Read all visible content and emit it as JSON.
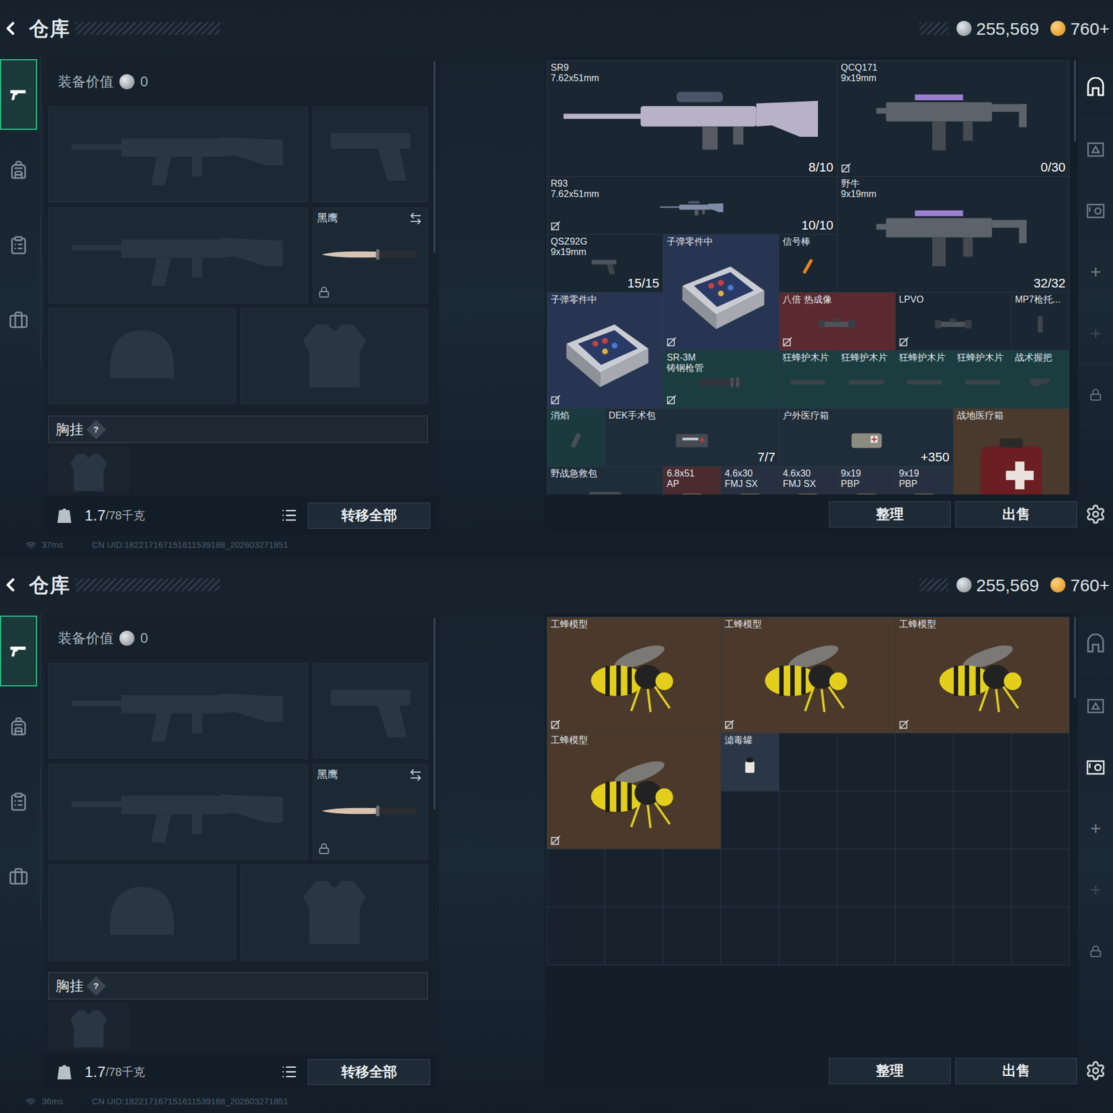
{
  "screens": [
    {
      "header": {
        "title": "仓库",
        "currency": [
          {
            "value": "255,569",
            "kind": "silver"
          },
          {
            "value": "760+",
            "kind": "gold"
          }
        ]
      },
      "side_tabs": [
        {
          "kind": "weapons",
          "selected": true
        },
        {
          "kind": "gear",
          "selected": false
        },
        {
          "kind": "tasks",
          "selected": false
        },
        {
          "kind": "cases",
          "selected": false
        }
      ],
      "loadout": {
        "value_label": "装备价值",
        "value": "0",
        "knife": {
          "name": "黑鹰",
          "locked": true
        },
        "chest_rig": {
          "label": "胸挂",
          "help": "?"
        },
        "weight": "1.7",
        "capacity": "/78千克",
        "transfer_button": "转移全部"
      },
      "stash": {
        "items": [
          {
            "name": "SR9",
            "subtitle": "7.62x51mm",
            "count": "8/10",
            "color": "#1a2631",
            "marked": false,
            "kind": "rifle"
          },
          {
            "name": "QCQ171",
            "subtitle": "9x19mm",
            "count": "0/30",
            "color": "#1a2631",
            "marked": true,
            "kind": "smg"
          },
          {
            "name": "R93",
            "subtitle": "7.62x51mm",
            "count": "10/10",
            "color": "#1a2631",
            "marked": true,
            "kind": "sniper"
          },
          {
            "name": "野牛",
            "subtitle": "9x19mm",
            "count": "32/32",
            "color": "#1a2631",
            "marked": false,
            "kind": "smg"
          },
          {
            "name": "QSZ92G",
            "subtitle": "9x19mm",
            "count": "15/15",
            "color": "#1a2631",
            "marked": false,
            "kind": "pistol"
          },
          {
            "name": "子弹零件中",
            "color": "#283552",
            "marked": true,
            "kind": "ammobox"
          },
          {
            "name": "信号棒",
            "color": "#1a2631",
            "marked": false,
            "kind": "flare"
          },
          {
            "name": "子弹零件中",
            "color": "#283552",
            "marked": true,
            "kind": "ammobox"
          },
          {
            "name": "八倍 热成像",
            "color": "#5b2a30",
            "marked": true,
            "kind": "scope"
          },
          {
            "name": "LPVO",
            "color": "#1a2631",
            "marked": true,
            "kind": "scope"
          },
          {
            "name": "MP7枪托...",
            "color": "#1a2631",
            "marked": false,
            "kind": "stock"
          },
          {
            "name": "SR-3M",
            "subtitle": "铸钢枪管",
            "color": "#1b3d40",
            "marked": true,
            "kind": "barrel"
          },
          {
            "name": "狂蜂护木片",
            "color": "#1b3d40",
            "marked": false,
            "kind": "handguard"
          },
          {
            "name": "狂蜂护木片",
            "color": "#1b3d40",
            "marked": false,
            "kind": "handguard"
          },
          {
            "name": "狂蜂护木片",
            "color": "#1b3d40",
            "marked": false,
            "kind": "handguard"
          },
          {
            "name": "狂蜂护木片",
            "color": "#1b3d40",
            "marked": false,
            "kind": "handguard"
          },
          {
            "name": "战术握把",
            "color": "#1b3d40",
            "marked": false,
            "kind": "grip"
          },
          {
            "name": "消焰",
            "color": "#1b3a3d",
            "marked": false,
            "kind": "muzzle"
          },
          {
            "name": "DEK手术包",
            "count": "7/7",
            "color": "#1f2c3a",
            "marked": false,
            "kind": "medkit"
          },
          {
            "name": "户外医疗箱",
            "count": "+350",
            "color": "#1f2c3a",
            "marked": false,
            "kind": "medbag"
          },
          {
            "name": "战地医疗箱",
            "color": "#4a3a2e",
            "marked": false,
            "kind": "medcase"
          },
          {
            "name": "野战急救包",
            "color": "#1f2c3a",
            "marked": false,
            "kind": "medkit"
          },
          {
            "name": "6.8x51",
            "subtitle": "AP",
            "color": "#4a2c30",
            "marked": false,
            "kind": "ammo"
          },
          {
            "name": "4.6x30",
            "subtitle": "FMJ SX",
            "color": "#263040",
            "marked": false,
            "kind": "ammo"
          },
          {
            "name": "4.6x30",
            "subtitle": "FMJ SX",
            "color": "#263040",
            "marked": false,
            "kind": "ammo"
          },
          {
            "name": "9x19",
            "subtitle": "PBP",
            "color": "#263040",
            "marked": false,
            "kind": "ammo"
          },
          {
            "name": "9x19",
            "subtitle": "PBP",
            "color": "#263040",
            "marked": false,
            "kind": "ammo"
          }
        ]
      },
      "rail": [
        {
          "kind": "vault-a",
          "selected": true,
          "disabled": false
        },
        {
          "kind": "vault-b",
          "selected": false,
          "disabled": false
        },
        {
          "kind": "vault-c",
          "selected": false,
          "disabled": false
        },
        {
          "kind": "add",
          "text": "+",
          "selected": false,
          "disabled": false
        },
        {
          "kind": "add",
          "text": "+",
          "selected": false,
          "disabled": true
        },
        {
          "kind": "lock",
          "selected": false,
          "disabled": false
        }
      ],
      "buttons": [
        {
          "label": "整理"
        },
        {
          "label": "出售"
        }
      ],
      "status": {
        "ping": "37ms",
        "uid": "CN UID:182217167151611539188_202603271851"
      }
    },
    {
      "header": {
        "title": "仓库",
        "currency": [
          {
            "value": "255,569",
            "kind": "silver"
          },
          {
            "value": "760+",
            "kind": "gold"
          }
        ]
      },
      "side_tabs": [
        {
          "kind": "weapons",
          "selected": true
        },
        {
          "kind": "gear",
          "selected": false
        },
        {
          "kind": "tasks",
          "selected": false
        },
        {
          "kind": "cases",
          "selected": false
        }
      ],
      "loadout": {
        "value_label": "装备价值",
        "value": "0",
        "knife": {
          "name": "黑鹰",
          "locked": true
        },
        "chest_rig": {
          "label": "胸挂",
          "help": "?"
        },
        "weight": "1.7",
        "capacity": "/78千克",
        "transfer_button": "转移全部"
      },
      "stash": {
        "items": [
          {
            "name": "工蜂模型",
            "color": "#4b3a2b",
            "marked": true,
            "kind": "bee"
          },
          {
            "name": "工蜂模型",
            "color": "#4b3a2b",
            "marked": true,
            "kind": "bee"
          },
          {
            "name": "工蜂模型",
            "color": "#4b3a2b",
            "marked": true,
            "kind": "bee"
          },
          {
            "name": "工蜂模型",
            "color": "#4b3a2b",
            "marked": true,
            "kind": "bee"
          },
          {
            "name": "滤毒罐",
            "color": "#2b3746",
            "marked": false,
            "kind": "canister"
          }
        ]
      },
      "rail": [
        {
          "kind": "vault-a",
          "selected": false,
          "disabled": false
        },
        {
          "kind": "vault-b",
          "selected": false,
          "disabled": false
        },
        {
          "kind": "vault-c",
          "selected": true,
          "disabled": false
        },
        {
          "kind": "add",
          "text": "+",
          "selected": false,
          "disabled": false
        },
        {
          "kind": "add",
          "text": "+",
          "selected": false,
          "disabled": true
        },
        {
          "kind": "lock",
          "selected": false,
          "disabled": false
        }
      ],
      "buttons": [
        {
          "label": "整理"
        },
        {
          "label": "出售"
        }
      ],
      "status": {
        "ping": "36ms",
        "uid": "CN UID:182217167151611539188_202603271851"
      }
    }
  ]
}
